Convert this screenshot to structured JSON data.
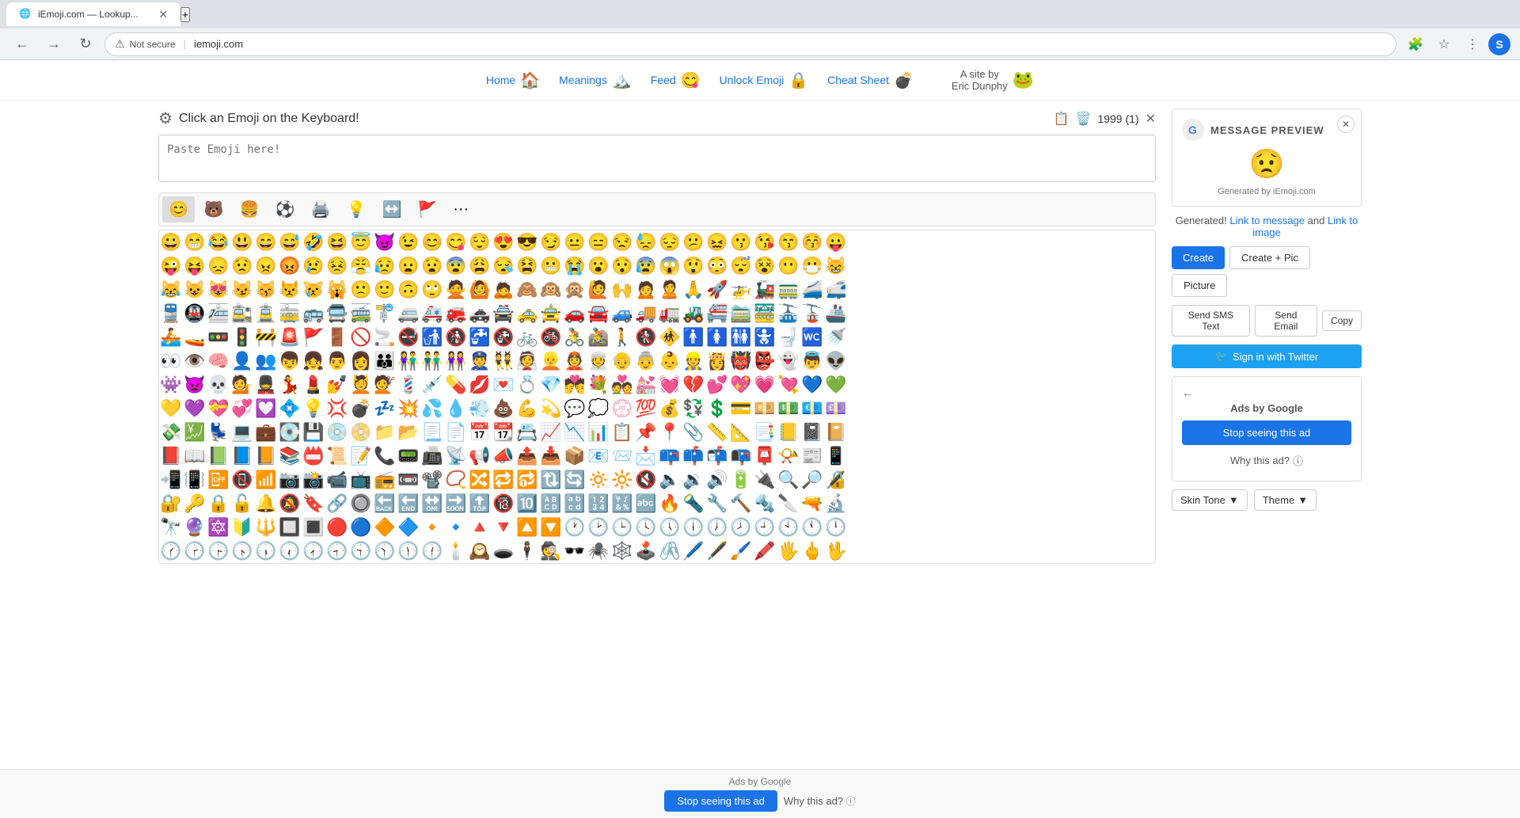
{
  "browser": {
    "tab_title": "iEmoji.com — Lookup...",
    "tab_favicon": "🌐",
    "url": "iemoji.com",
    "security_label": "Not secure",
    "add_tab_label": "+",
    "user_initial": "S"
  },
  "nav": {
    "items": [
      {
        "label": "Home",
        "emoji": "🏠"
      },
      {
        "label": "Meanings",
        "emoji": "🏔️"
      },
      {
        "label": "Feed",
        "emoji": "😋"
      },
      {
        "label": "Unlock Emoji",
        "emoji": "🔒"
      },
      {
        "label": "Cheat Sheet",
        "emoji": "💣"
      }
    ],
    "site_credit": "A site by\nEric Dunphy",
    "site_frog": "🐸"
  },
  "toolbar": {
    "instruction": "Click an Emoji on the Keyboard!",
    "paste_placeholder": "Paste Emoji here!",
    "char_count": "1999 (1)"
  },
  "category_tabs": [
    {
      "emoji": "😊",
      "label": "Faces"
    },
    {
      "emoji": "🐻",
      "label": "Animals"
    },
    {
      "emoji": "🍔",
      "label": "Food"
    },
    {
      "emoji": "⚽",
      "label": "Activity"
    },
    {
      "emoji": "🖨️",
      "label": "Objects"
    },
    {
      "emoji": "💡",
      "label": "Symbols"
    },
    {
      "emoji": "↔️",
      "label": "Arrows"
    },
    {
      "emoji": "🚩",
      "label": "Flags"
    },
    {
      "emoji": "···",
      "label": "More"
    }
  ],
  "emoji_rows": [
    [
      "😀",
      "😁",
      "😂",
      "😃",
      "😄",
      "😅",
      "🤣",
      "😆",
      "😇",
      "😈",
      "😉",
      "😊",
      "😋",
      "😌",
      "😍",
      "😎",
      "😏",
      "😐",
      "😑",
      "😒",
      "😓",
      "😔",
      "😕",
      "😖",
      "😗",
      "😘",
      "😙",
      "😚",
      "😛"
    ],
    [
      "😜",
      "😝",
      "😞",
      "😟",
      "😠",
      "😡",
      "😢",
      "😣",
      "😤",
      "😥",
      "😦",
      "😧",
      "😨",
      "😩",
      "😪",
      "😫",
      "😬",
      "😭",
      "😮",
      "😯",
      "😰",
      "😱",
      "😲",
      "😳",
      "😴",
      "😵",
      "😶",
      "😷",
      "😸"
    ],
    [
      "😹",
      "😺",
      "😻",
      "😼",
      "😽",
      "😾",
      "😿",
      "🙀",
      "🙁",
      "🙂",
      "🙃",
      "🙄",
      "🙅",
      "🙆",
      "🙇",
      "🙈",
      "🙉",
      "🙊",
      "🙋",
      "🙌",
      "🙍",
      "🙎",
      "🙏",
      "🚀",
      "🚁",
      "🚂",
      "🚃",
      "🚄",
      "🚅"
    ],
    [
      "🚆",
      "🚇",
      "🚈",
      "🚉",
      "🚊",
      "🚋",
      "🚌",
      "🚍",
      "🚎",
      "🚏",
      "🚐",
      "🚑",
      "🚒",
      "🚓",
      "🚔",
      "🚕",
      "🚖",
      "🚗",
      "🚘",
      "🚙",
      "🚚",
      "🚛",
      "🚜",
      "🚝",
      "🚞",
      "🚟",
      "🚠",
      "🚡",
      "🚢"
    ],
    [
      "🚣",
      "🚤",
      "🚥",
      "🚦",
      "🚧",
      "🚨",
      "🚩",
      "🚪",
      "🚫",
      "🚬",
      "🚭",
      "🚮",
      "🚯",
      "🚰",
      "🚱",
      "🚲",
      "🚳",
      "🚴",
      "🚵",
      "🚶",
      "🚷",
      "🚸",
      "🚹",
      "🚺",
      "🚻",
      "🚼",
      "🚽",
      "🚾",
      "🚿"
    ],
    [
      "👀",
      "👁️",
      "🧠",
      "👤",
      "👥",
      "👦",
      "👧",
      "👨",
      "👩",
      "👪",
      "👫",
      "👬",
      "👭",
      "👮",
      "👯",
      "👰",
      "👱",
      "👲",
      "👳",
      "👴",
      "👵",
      "👶",
      "👷",
      "👸",
      "👹",
      "👺",
      "👻",
      "👼",
      "👽"
    ],
    [
      "👾",
      "👿",
      "💀",
      "💁",
      "💂",
      "💃",
      "💄",
      "💅",
      "💆",
      "💇",
      "💈",
      "💉",
      "💊",
      "💋",
      "💌",
      "💍",
      "💎",
      "💏",
      "💐",
      "💑",
      "💒",
      "💓",
      "💔",
      "💕",
      "💖",
      "💗",
      "💘",
      "💙",
      "💚"
    ],
    [
      "💛",
      "💜",
      "💝",
      "💞",
      "💟",
      "💠",
      "💡",
      "💢",
      "💣",
      "💤",
      "💥",
      "💦",
      "💧",
      "💨",
      "💩",
      "💪",
      "💫",
      "💬",
      "💭",
      "💮",
      "💯",
      "💰",
      "💱",
      "💲",
      "💳",
      "💴",
      "💵",
      "💶",
      "💷"
    ],
    [
      "💸",
      "💹",
      "💺",
      "💻",
      "💼",
      "💽",
      "💾",
      "💿",
      "📀",
      "📁",
      "📂",
      "📃",
      "📄",
      "📅",
      "📆",
      "📇",
      "📈",
      "📉",
      "📊",
      "📋",
      "📌",
      "📍",
      "📎",
      "📏",
      "📐",
      "📑",
      "📒",
      "📓",
      "📔"
    ],
    [
      "📕",
      "📖",
      "📗",
      "📘",
      "📙",
      "📚",
      "📛",
      "📜",
      "📝",
      "📞",
      "📟",
      "📠",
      "📡",
      "📢",
      "📣",
      "📤",
      "📥",
      "📦",
      "📧",
      "📨",
      "📩",
      "📪",
      "📫",
      "📬",
      "📭",
      "📮",
      "📯",
      "📰",
      "📱"
    ],
    [
      "📲",
      "📳",
      "📴",
      "📵",
      "📶",
      "📷",
      "📸",
      "📹",
      "📺",
      "📻",
      "📼",
      "📽️",
      "📿",
      "🔀",
      "🔁",
      "🔂",
      "🔃",
      "🔄",
      "🔅",
      "🔆",
      "🔇",
      "🔈",
      "🔉",
      "🔊",
      "🔋",
      "🔌",
      "🔍",
      "🔎",
      "🔏"
    ],
    [
      "🔐",
      "🔑",
      "🔒",
      "🔓",
      "🔔",
      "🔕",
      "🔖",
      "🔗",
      "🔘",
      "🔙",
      "🔚",
      "🔛",
      "🔜",
      "🔝",
      "🔞",
      "🔟",
      "🔠",
      "🔡",
      "🔢",
      "🔣",
      "🔤",
      "🔥",
      "🔦",
      "🔧",
      "🔨",
      "🔩",
      "🔪",
      "🔫",
      "🔬"
    ],
    [
      "🔭",
      "🔮",
      "🔯",
      "🔰",
      "🔱",
      "🔲",
      "🔳",
      "🔴",
      "🔵",
      "🔶",
      "🔷",
      "🔸",
      "🔹",
      "🔺",
      "🔻",
      "🔼",
      "🔽",
      "🕐",
      "🕑",
      "🕒",
      "🕓",
      "🕔",
      "🕕",
      "🕖",
      "🕗",
      "🕘",
      "🕙",
      "🕚",
      "🕛"
    ],
    [
      "🕜",
      "🕝",
      "🕞",
      "🕟",
      "🕠",
      "🕡",
      "🕢",
      "🕣",
      "🕤",
      "🕥",
      "🕦",
      "🕧",
      "🕯️",
      "🕰️",
      "🕳️",
      "🕴️",
      "🕵️",
      "🕶️",
      "🕷️",
      "🕸️",
      "🕹️",
      "🖇️",
      "🖊️",
      "🖋️",
      "🖌️",
      "🖍️",
      "🖐️",
      "🖕",
      "🖖"
    ]
  ],
  "message_preview": {
    "header": "MESSAGE PREVIEW",
    "emoji": "😟",
    "generated_by": "Generated by iEmoji.com"
  },
  "generated_links": {
    "text": "Generated!",
    "link_message": "Link to message",
    "and_text": "and",
    "link_image": "Link to image"
  },
  "buttons": {
    "create": "Create",
    "create_pic": "Create + Pic",
    "picture": "Picture",
    "send_sms": "Send SMS Text",
    "send_email": "Send Email",
    "copy": "Copy",
    "twitter_sign_in": "Sign in with Twitter"
  },
  "ads": {
    "label": "Ads by Google",
    "stop_ad": "Stop seeing this ad",
    "why_ad": "Why this ad?",
    "bottom_stop_ad": "Stop seeing this ad",
    "bottom_why_ad": "Why this ad?"
  },
  "bottom_controls": {
    "skin_tone": "Skin Tone",
    "theme": "Theme"
  }
}
